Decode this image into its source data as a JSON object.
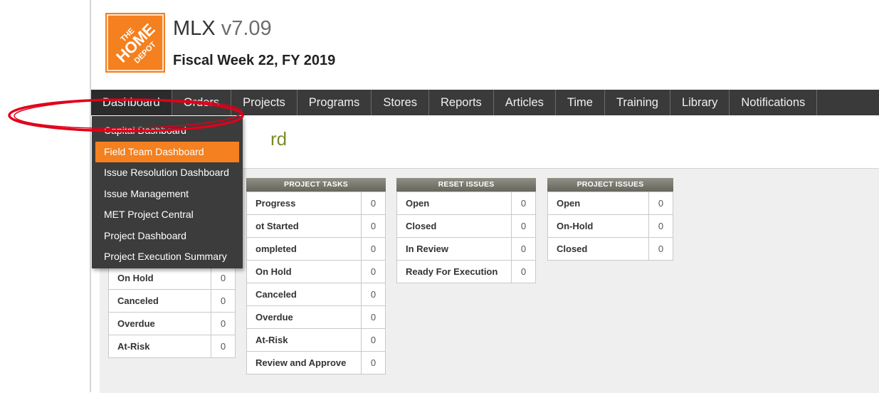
{
  "header": {
    "logo_text": "THE HOME DEPOT",
    "app_name": "MLX",
    "version": "v7.09",
    "fiscal_week": "Fiscal Week 22, FY 2019"
  },
  "nav": [
    "Dashboard",
    "Orders",
    "Projects",
    "Programs",
    "Stores",
    "Reports",
    "Articles",
    "Time",
    "Training",
    "Library",
    "Notifications"
  ],
  "dashboard_menu": {
    "items": [
      "Capital Dashboard",
      "Field Team Dashboard",
      "Issue Resolution Dashboard",
      "Issue Management",
      "MET Project Central",
      "Project Dashboard",
      "Project Execution Summary"
    ],
    "selected": "Field Team Dashboard"
  },
  "page_title": "rd",
  "panels": {
    "projects": {
      "rows": [
        {
          "label": "On Hold",
          "value": "0"
        },
        {
          "label": "Canceled",
          "value": "0"
        },
        {
          "label": "Overdue",
          "value": "0"
        },
        {
          "label": "At-Risk",
          "value": "0"
        }
      ]
    },
    "project_tasks": {
      "title": "PROJECT TASKS",
      "rows": [
        {
          "label": "Progress",
          "value": "0"
        },
        {
          "label": "ot Started",
          "value": "0"
        },
        {
          "label": "ompleted",
          "value": "0"
        },
        {
          "label": "On Hold",
          "value": "0"
        },
        {
          "label": "Canceled",
          "value": "0"
        },
        {
          "label": "Overdue",
          "value": "0"
        },
        {
          "label": "At-Risk",
          "value": "0"
        },
        {
          "label": "Review and Approve",
          "value": "0"
        }
      ]
    },
    "reset_issues": {
      "title": "RESET ISSUES",
      "rows": [
        {
          "label": "Open",
          "value": "0"
        },
        {
          "label": "Closed",
          "value": "0"
        },
        {
          "label": "In Review",
          "value": "0"
        },
        {
          "label": "Ready For Execution",
          "value": "0"
        }
      ]
    },
    "project_issues": {
      "title": "PROJECT ISSUES",
      "rows": [
        {
          "label": "Open",
          "value": "0"
        },
        {
          "label": "On-Hold",
          "value": "0"
        },
        {
          "label": "Closed",
          "value": "0"
        }
      ]
    }
  },
  "colors": {
    "brand_orange": "#f4801f",
    "nav_bg": "#3a3a3a",
    "title_green": "#7b8b2a",
    "annotation_red": "#e0001a"
  }
}
